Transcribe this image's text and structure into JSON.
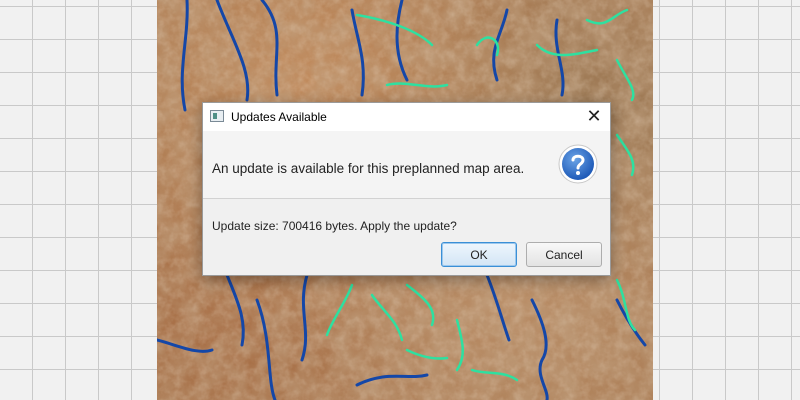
{
  "dialog": {
    "title": "Updates Available",
    "header_text": "An update is available for this preplanned map area.",
    "content_text": "Update size: 700416 bytes. Apply the update?",
    "ok_label": "OK",
    "cancel_label": "Cancel",
    "close_glyph": "✕",
    "header_icon": "question-icon"
  },
  "colors": {
    "trail_blue": "#1447a8",
    "trail_green": "#2ee0a0",
    "accent": "#3a8fd6"
  }
}
